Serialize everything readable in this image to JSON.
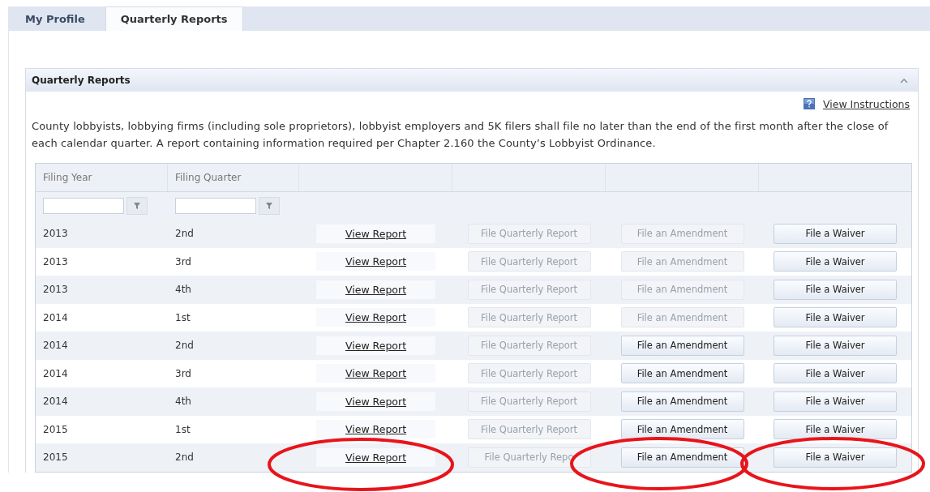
{
  "tabs": [
    {
      "label": "My Profile",
      "selected": false
    },
    {
      "label": "Quarterly Reports",
      "selected": true
    }
  ],
  "panel": {
    "title": "Quarterly Reports",
    "expanded": true,
    "instructions_link": "View Instructions",
    "description": "County lobbyists, lobbying firms (including sole proprietors), lobbyist employers and 5K filers shall file no later than the end of the first month after the close of each calendar quarter. A report containing information required per Chapter 2.160 the County’s Lobbyist Ordinance."
  },
  "table": {
    "columns": [
      "Filing Year",
      "Filing Quarter"
    ],
    "rows": [
      {
        "year": "2013",
        "quarter": "2nd",
        "view": "View Report",
        "file_quarterly": {
          "label": "File Quarterly Report",
          "disabled": true
        },
        "amendment": {
          "label": "File an Amendment",
          "disabled": true
        },
        "waiver": {
          "label": "File a Waiver",
          "disabled": false
        }
      },
      {
        "year": "2013",
        "quarter": "3rd",
        "view": "View Report",
        "file_quarterly": {
          "label": "File Quarterly Report",
          "disabled": true
        },
        "amendment": {
          "label": "File an Amendment",
          "disabled": true
        },
        "waiver": {
          "label": "File a Waiver",
          "disabled": false
        }
      },
      {
        "year": "2013",
        "quarter": "4th",
        "view": "View Report",
        "file_quarterly": {
          "label": "File Quarterly Report",
          "disabled": true
        },
        "amendment": {
          "label": "File an Amendment",
          "disabled": true
        },
        "waiver": {
          "label": "File a Waiver",
          "disabled": false
        }
      },
      {
        "year": "2014",
        "quarter": "1st",
        "view": "View Report",
        "file_quarterly": {
          "label": "File Quarterly Report",
          "disabled": true
        },
        "amendment": {
          "label": "File an Amendment",
          "disabled": true
        },
        "waiver": {
          "label": "File a Waiver",
          "disabled": false
        }
      },
      {
        "year": "2014",
        "quarter": "2nd",
        "view": "View Report",
        "file_quarterly": {
          "label": "File Quarterly Report",
          "disabled": true
        },
        "amendment": {
          "label": "File an Amendment",
          "disabled": false
        },
        "waiver": {
          "label": "File a Waiver",
          "disabled": false
        }
      },
      {
        "year": "2014",
        "quarter": "3rd",
        "view": "View Report",
        "file_quarterly": {
          "label": "File Quarterly Report",
          "disabled": true
        },
        "amendment": {
          "label": "File an Amendment",
          "disabled": false
        },
        "waiver": {
          "label": "File a Waiver",
          "disabled": false
        }
      },
      {
        "year": "2014",
        "quarter": "4th",
        "view": "View Report",
        "file_quarterly": {
          "label": "File Quarterly Report",
          "disabled": true
        },
        "amendment": {
          "label": "File an Amendment",
          "disabled": false
        },
        "waiver": {
          "label": "File a Waiver",
          "disabled": false
        }
      },
      {
        "year": "2015",
        "quarter": "1st",
        "view": "View Report",
        "file_quarterly": {
          "label": "File Quarterly Report",
          "disabled": true
        },
        "amendment": {
          "label": "File an Amendment",
          "disabled": false
        },
        "waiver": {
          "label": "File a Waiver",
          "disabled": false
        }
      },
      {
        "year": "2015",
        "quarter": "2nd",
        "view": "View Report",
        "file_quarterly": {
          "label": "File Quarterly Repo",
          "disabled": true
        },
        "amendment": {
          "label": "File an Amendment",
          "disabled": false
        },
        "waiver": {
          "label": "File a Waiver",
          "disabled": false
        }
      }
    ]
  }
}
